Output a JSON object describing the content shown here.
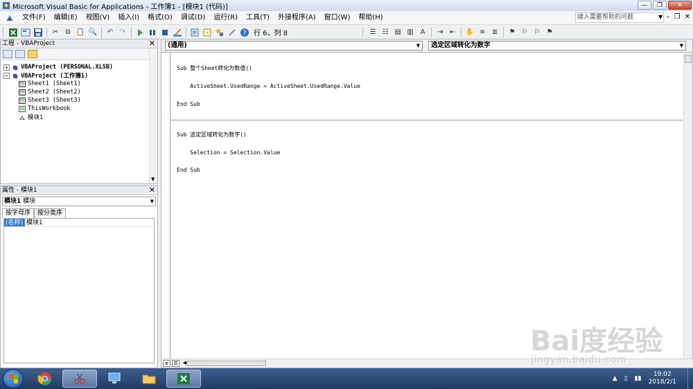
{
  "window": {
    "title": "Microsoft Visual Basic for Applications - 工作簿1 - [模块1 (代码)]"
  },
  "menu": {
    "items": [
      "文件(F)",
      "编辑(E)",
      "视图(V)",
      "插入(I)",
      "格式(O)",
      "调试(D)",
      "运行(R)",
      "工具(T)",
      "外接程序(A)",
      "窗口(W)",
      "帮助(H)"
    ],
    "help_placeholder": "键入需要帮助的问题"
  },
  "toolbar": {
    "cursor_position": "行 6，列 8"
  },
  "project_panel": {
    "title": "工程 - VBAProject",
    "tree": [
      {
        "label": "VBAProject (PERSONAL.XLSB)",
        "bold": true
      },
      {
        "label": "VBAProject (工作簿1)",
        "bold": true
      },
      {
        "label": "Sheet1 (Sheet1)"
      },
      {
        "label": "Sheet2 (Sheet2)"
      },
      {
        "label": "Sheet3 (Sheet3)"
      },
      {
        "label": "ThisWorkbook"
      },
      {
        "label": "模块1"
      }
    ]
  },
  "properties_panel": {
    "title": "属性 - 模块1",
    "object_name": "模块1",
    "object_type": "模块",
    "tabs": [
      "按字母序",
      "按分类序"
    ],
    "rows": [
      {
        "key": "(名称)",
        "value": "模块1"
      }
    ]
  },
  "code_window": {
    "object_combo": "(通用)",
    "procedure_combo": "选定区域转化为数字",
    "lines": [
      "Sub 整个Sheet转化为数值()",
      "    ActiveSheet.UsedRange = ActiveSheet.UsedRange.Value",
      "End Sub",
      "Sub 选定区域转化为数字()",
      "    Selection = Selection.Value",
      "End Sub"
    ]
  },
  "taskbar": {
    "time": "19:02",
    "date": "2018/2/1"
  },
  "watermark": {
    "logo": "Bai度经验",
    "url": "jingyan.baidu.com"
  },
  "colors": {
    "selection": "#3a78d6",
    "taskbar": "#1f3b63"
  }
}
